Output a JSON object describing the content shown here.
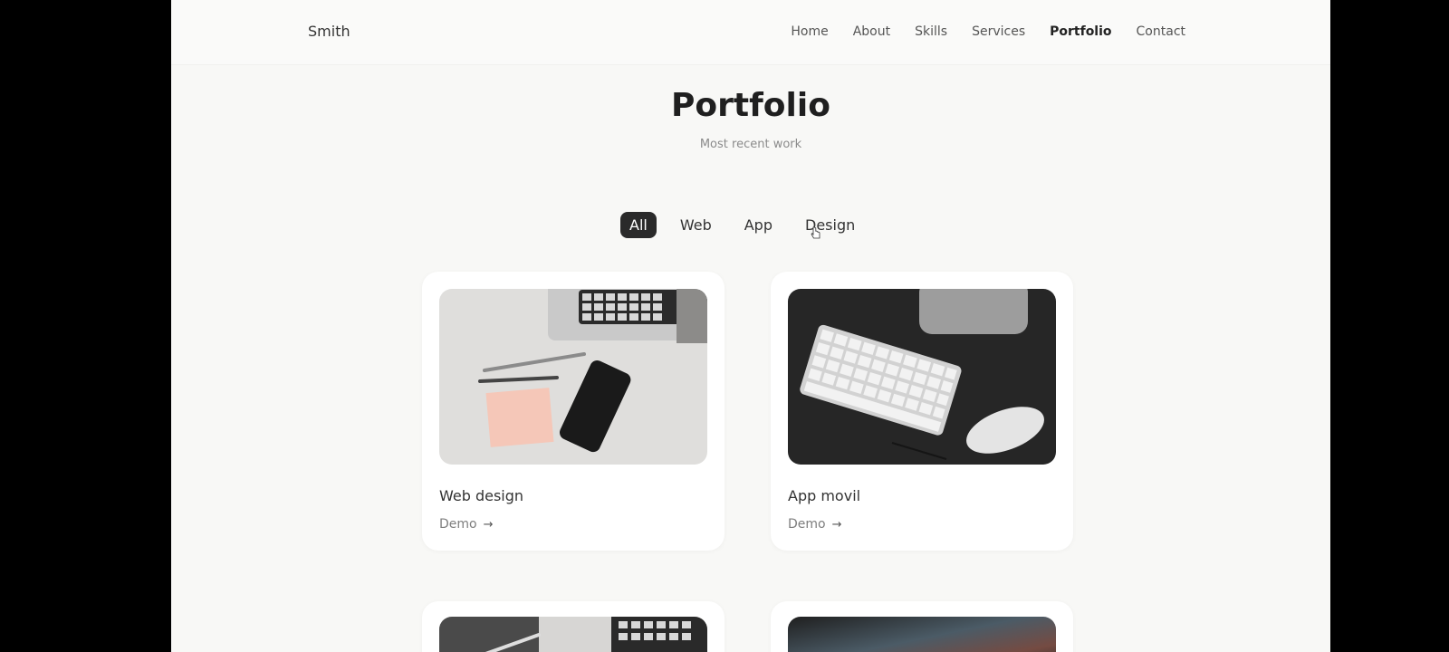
{
  "header": {
    "logo": "Smith",
    "nav": [
      {
        "label": "Home"
      },
      {
        "label": "About"
      },
      {
        "label": "Skills"
      },
      {
        "label": "Services"
      },
      {
        "label": "Portfolio",
        "active": true
      },
      {
        "label": "Contact"
      }
    ]
  },
  "section": {
    "title": "Portfolio",
    "subtitle": "Most recent work"
  },
  "filters": [
    {
      "label": "All",
      "active": true
    },
    {
      "label": "Web"
    },
    {
      "label": "App"
    },
    {
      "label": "Design"
    }
  ],
  "cards": [
    {
      "title": "Web design",
      "link": "Demo"
    },
    {
      "title": "App movil",
      "link": "Demo"
    }
  ],
  "icons": {
    "arrow": "arrow-right-icon",
    "scroll_top": "arrow-up-icon"
  },
  "colors": {
    "page_bg": "#f8f8f6",
    "active_filter": "#2a2a2a",
    "scroll_btn": "#2f2f2f"
  }
}
